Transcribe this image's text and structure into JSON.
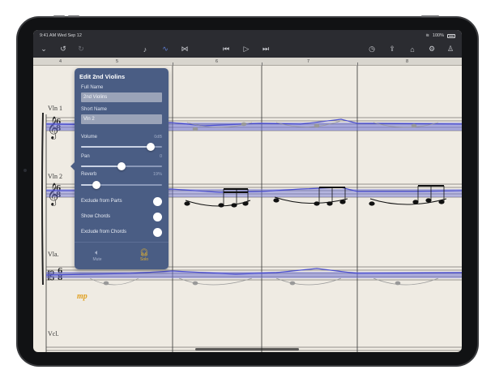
{
  "status_bar": {
    "time": "9:41 AM  Wed Sep 12",
    "battery": "100%"
  },
  "toolbar": {
    "icons": [
      "chevron-down-icon",
      "undo-icon",
      "redo-icon",
      "tuner-icon",
      "wave-icon",
      "metronome-icon",
      "rewind-icon",
      "play-icon",
      "forward-icon",
      "clock-icon",
      "share-icon",
      "home-icon",
      "settings-icon",
      "person-icon"
    ]
  },
  "ruler": {
    "measures": [
      "4",
      "5",
      "6",
      "7",
      "8"
    ]
  },
  "score": {
    "instruments": [
      "Vln 1",
      "Vln 2",
      "Vla.",
      "Vcl."
    ],
    "dynamic": "mp"
  },
  "popover": {
    "title": "Edit 2nd Violins",
    "full_name_label": "Full Name",
    "full_name_value": "2nd Violins",
    "short_name_label": "Short Name",
    "short_name_value": "Vln 2",
    "volume_label": "Volume",
    "volume_value": "0dB",
    "volume_level": 0.86,
    "pan_label": "Pan",
    "pan_value": "0",
    "pan_level": 0.5,
    "reverb_label": "Reverb",
    "reverb_value": "19%",
    "reverb_level": 0.19,
    "toggles": [
      {
        "label": "Exclude from Parts",
        "on": false
      },
      {
        "label": "Show Chords",
        "on": false
      },
      {
        "label": "Exclude from Chords",
        "on": false
      }
    ],
    "mute_label": "Mute",
    "solo_label": "Solo",
    "accent": "#e0b030"
  }
}
